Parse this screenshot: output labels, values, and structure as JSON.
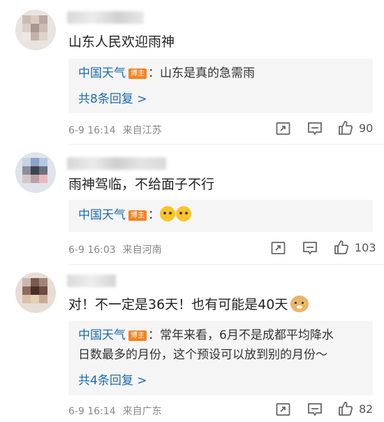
{
  "comments": [
    {
      "text": "山东人民欢迎雨神",
      "reply": {
        "author": "中国天气",
        "badge": "博主",
        "text": "：山东是真的急需雨",
        "more": "共8条回复 >"
      },
      "time": "6-9 16:14",
      "location": "来自江苏",
      "likes": "90"
    },
    {
      "text": "雨神驾临，不给面子不行",
      "reply": {
        "author": "中国天气",
        "badge": "博主",
        "text": "："
      },
      "time": "6-9 16:03",
      "location": "来自河南",
      "likes": "103"
    },
    {
      "text": "对！不一定是36天！也有可能是40天",
      "reply": {
        "author": "中国天气",
        "badge": "博主",
        "text_line1": "：常年来看，6月不是成都平均降水",
        "text_line2": "日数最多的月份，这个预设可以放到别的月份～",
        "more": "共4条回复 >"
      },
      "time": "6-9 16:14",
      "location": "来自广东",
      "likes": "82"
    }
  ],
  "icons": {
    "repost": "repost-icon",
    "comment": "comment-icon",
    "like": "thumbs-up-icon"
  },
  "colors": {
    "link": "#1b6aae",
    "badge": "#f58220",
    "reply_bg": "#f5f5f5",
    "meta": "#888888"
  }
}
